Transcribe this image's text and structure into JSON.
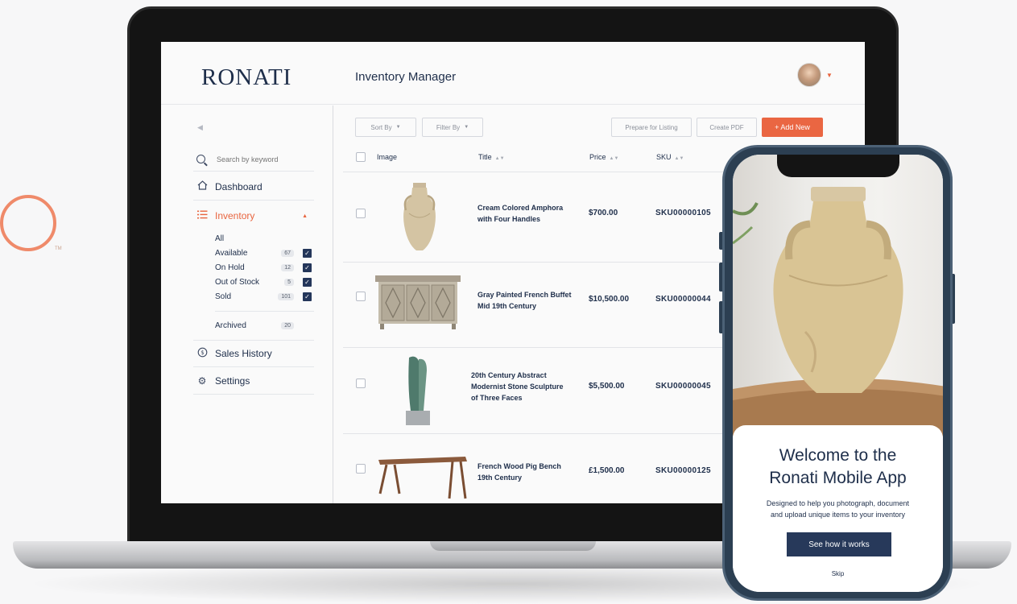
{
  "brand": {
    "tm": "TM"
  },
  "header": {
    "logo": "RONATI",
    "title": "Inventory Manager"
  },
  "sidebar": {
    "search_placeholder": "Search by keyword",
    "nav": [
      {
        "label": "Dashboard"
      },
      {
        "label": "Inventory"
      },
      {
        "label": "Sales History"
      },
      {
        "label": "Settings"
      }
    ],
    "inventory_sub": [
      {
        "label": "All",
        "count": ""
      },
      {
        "label": "Available",
        "count": "67"
      },
      {
        "label": "On Hold",
        "count": "12"
      },
      {
        "label": "Out of Stock",
        "count": "5"
      },
      {
        "label": "Sold",
        "count": "101"
      },
      {
        "label": "Archived",
        "count": "20"
      }
    ]
  },
  "toolbar": {
    "sort_by": "Sort By",
    "filter_by": "Filter By",
    "prepare": "Prepare for Listing",
    "create_pdf": "Create PDF",
    "add_new": "+ Add New"
  },
  "table": {
    "columns": [
      "Image",
      "Title",
      "Price",
      "SKU"
    ],
    "rows": [
      {
        "title_l1": "Cream Colored Amphora",
        "title_l2": "with Four Handles",
        "title_l3": "",
        "price": "$700.00",
        "sku": "SKU00000105"
      },
      {
        "title_l1": "Gray Painted French Buffet",
        "title_l2": "Mid 19th Century",
        "title_l3": "",
        "price": "$10,500.00",
        "sku": "SKU00000044"
      },
      {
        "title_l1": "20th Century Abstract",
        "title_l2": "Modernist Stone Sculpture",
        "title_l3": "of Three Faces",
        "price": "$5,500.00",
        "sku": "SKU00000045"
      },
      {
        "title_l1": "French Wood Pig Bench",
        "title_l2": "19th Century",
        "title_l3": "",
        "price": "£1,500.00",
        "sku": "SKU00000125"
      }
    ]
  },
  "phone": {
    "welcome_l1": "Welcome to the",
    "welcome_l2": "Ronati Mobile App",
    "sub_l1": "Designed to help you photograph, document",
    "sub_l2": "and upload unique items to your inventory",
    "cta": "See how it works",
    "skip": "Skip"
  },
  "colors": {
    "accent": "#ea6642",
    "navy": "#1e2e4a",
    "button": "#27395a"
  }
}
